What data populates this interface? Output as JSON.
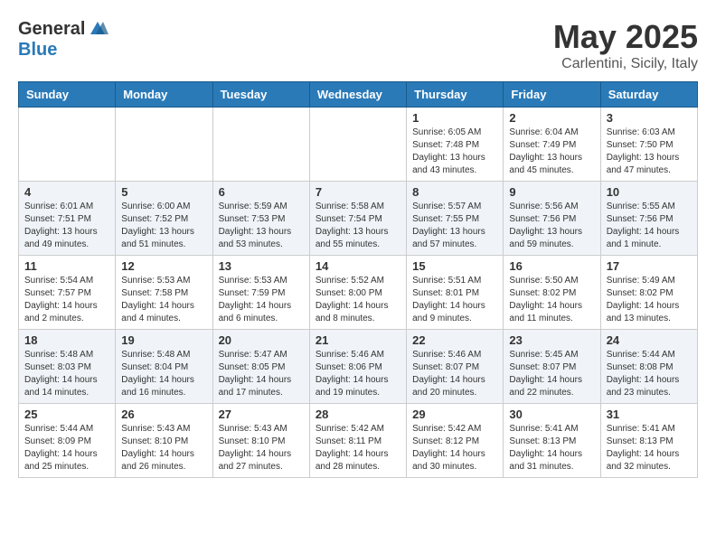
{
  "logo": {
    "general": "General",
    "blue": "Blue"
  },
  "title": "May 2025",
  "subtitle": "Carlentini, Sicily, Italy",
  "days_of_week": [
    "Sunday",
    "Monday",
    "Tuesday",
    "Wednesday",
    "Thursday",
    "Friday",
    "Saturday"
  ],
  "weeks": [
    [
      {
        "day": "",
        "sunrise": "",
        "sunset": "",
        "daylight": ""
      },
      {
        "day": "",
        "sunrise": "",
        "sunset": "",
        "daylight": ""
      },
      {
        "day": "",
        "sunrise": "",
        "sunset": "",
        "daylight": ""
      },
      {
        "day": "",
        "sunrise": "",
        "sunset": "",
        "daylight": ""
      },
      {
        "day": "1",
        "sunrise": "Sunrise: 6:05 AM",
        "sunset": "Sunset: 7:48 PM",
        "daylight": "Daylight: 13 hours and 43 minutes."
      },
      {
        "day": "2",
        "sunrise": "Sunrise: 6:04 AM",
        "sunset": "Sunset: 7:49 PM",
        "daylight": "Daylight: 13 hours and 45 minutes."
      },
      {
        "day": "3",
        "sunrise": "Sunrise: 6:03 AM",
        "sunset": "Sunset: 7:50 PM",
        "daylight": "Daylight: 13 hours and 47 minutes."
      }
    ],
    [
      {
        "day": "4",
        "sunrise": "Sunrise: 6:01 AM",
        "sunset": "Sunset: 7:51 PM",
        "daylight": "Daylight: 13 hours and 49 minutes."
      },
      {
        "day": "5",
        "sunrise": "Sunrise: 6:00 AM",
        "sunset": "Sunset: 7:52 PM",
        "daylight": "Daylight: 13 hours and 51 minutes."
      },
      {
        "day": "6",
        "sunrise": "Sunrise: 5:59 AM",
        "sunset": "Sunset: 7:53 PM",
        "daylight": "Daylight: 13 hours and 53 minutes."
      },
      {
        "day": "7",
        "sunrise": "Sunrise: 5:58 AM",
        "sunset": "Sunset: 7:54 PM",
        "daylight": "Daylight: 13 hours and 55 minutes."
      },
      {
        "day": "8",
        "sunrise": "Sunrise: 5:57 AM",
        "sunset": "Sunset: 7:55 PM",
        "daylight": "Daylight: 13 hours and 57 minutes."
      },
      {
        "day": "9",
        "sunrise": "Sunrise: 5:56 AM",
        "sunset": "Sunset: 7:56 PM",
        "daylight": "Daylight: 13 hours and 59 minutes."
      },
      {
        "day": "10",
        "sunrise": "Sunrise: 5:55 AM",
        "sunset": "Sunset: 7:56 PM",
        "daylight": "Daylight: 14 hours and 1 minute."
      }
    ],
    [
      {
        "day": "11",
        "sunrise": "Sunrise: 5:54 AM",
        "sunset": "Sunset: 7:57 PM",
        "daylight": "Daylight: 14 hours and 2 minutes."
      },
      {
        "day": "12",
        "sunrise": "Sunrise: 5:53 AM",
        "sunset": "Sunset: 7:58 PM",
        "daylight": "Daylight: 14 hours and 4 minutes."
      },
      {
        "day": "13",
        "sunrise": "Sunrise: 5:53 AM",
        "sunset": "Sunset: 7:59 PM",
        "daylight": "Daylight: 14 hours and 6 minutes."
      },
      {
        "day": "14",
        "sunrise": "Sunrise: 5:52 AM",
        "sunset": "Sunset: 8:00 PM",
        "daylight": "Daylight: 14 hours and 8 minutes."
      },
      {
        "day": "15",
        "sunrise": "Sunrise: 5:51 AM",
        "sunset": "Sunset: 8:01 PM",
        "daylight": "Daylight: 14 hours and 9 minutes."
      },
      {
        "day": "16",
        "sunrise": "Sunrise: 5:50 AM",
        "sunset": "Sunset: 8:02 PM",
        "daylight": "Daylight: 14 hours and 11 minutes."
      },
      {
        "day": "17",
        "sunrise": "Sunrise: 5:49 AM",
        "sunset": "Sunset: 8:02 PM",
        "daylight": "Daylight: 14 hours and 13 minutes."
      }
    ],
    [
      {
        "day": "18",
        "sunrise": "Sunrise: 5:48 AM",
        "sunset": "Sunset: 8:03 PM",
        "daylight": "Daylight: 14 hours and 14 minutes."
      },
      {
        "day": "19",
        "sunrise": "Sunrise: 5:48 AM",
        "sunset": "Sunset: 8:04 PM",
        "daylight": "Daylight: 14 hours and 16 minutes."
      },
      {
        "day": "20",
        "sunrise": "Sunrise: 5:47 AM",
        "sunset": "Sunset: 8:05 PM",
        "daylight": "Daylight: 14 hours and 17 minutes."
      },
      {
        "day": "21",
        "sunrise": "Sunrise: 5:46 AM",
        "sunset": "Sunset: 8:06 PM",
        "daylight": "Daylight: 14 hours and 19 minutes."
      },
      {
        "day": "22",
        "sunrise": "Sunrise: 5:46 AM",
        "sunset": "Sunset: 8:07 PM",
        "daylight": "Daylight: 14 hours and 20 minutes."
      },
      {
        "day": "23",
        "sunrise": "Sunrise: 5:45 AM",
        "sunset": "Sunset: 8:07 PM",
        "daylight": "Daylight: 14 hours and 22 minutes."
      },
      {
        "day": "24",
        "sunrise": "Sunrise: 5:44 AM",
        "sunset": "Sunset: 8:08 PM",
        "daylight": "Daylight: 14 hours and 23 minutes."
      }
    ],
    [
      {
        "day": "25",
        "sunrise": "Sunrise: 5:44 AM",
        "sunset": "Sunset: 8:09 PM",
        "daylight": "Daylight: 14 hours and 25 minutes."
      },
      {
        "day": "26",
        "sunrise": "Sunrise: 5:43 AM",
        "sunset": "Sunset: 8:10 PM",
        "daylight": "Daylight: 14 hours and 26 minutes."
      },
      {
        "day": "27",
        "sunrise": "Sunrise: 5:43 AM",
        "sunset": "Sunset: 8:10 PM",
        "daylight": "Daylight: 14 hours and 27 minutes."
      },
      {
        "day": "28",
        "sunrise": "Sunrise: 5:42 AM",
        "sunset": "Sunset: 8:11 PM",
        "daylight": "Daylight: 14 hours and 28 minutes."
      },
      {
        "day": "29",
        "sunrise": "Sunrise: 5:42 AM",
        "sunset": "Sunset: 8:12 PM",
        "daylight": "Daylight: 14 hours and 30 minutes."
      },
      {
        "day": "30",
        "sunrise": "Sunrise: 5:41 AM",
        "sunset": "Sunset: 8:13 PM",
        "daylight": "Daylight: 14 hours and 31 minutes."
      },
      {
        "day": "31",
        "sunrise": "Sunrise: 5:41 AM",
        "sunset": "Sunset: 8:13 PM",
        "daylight": "Daylight: 14 hours and 32 minutes."
      }
    ]
  ]
}
